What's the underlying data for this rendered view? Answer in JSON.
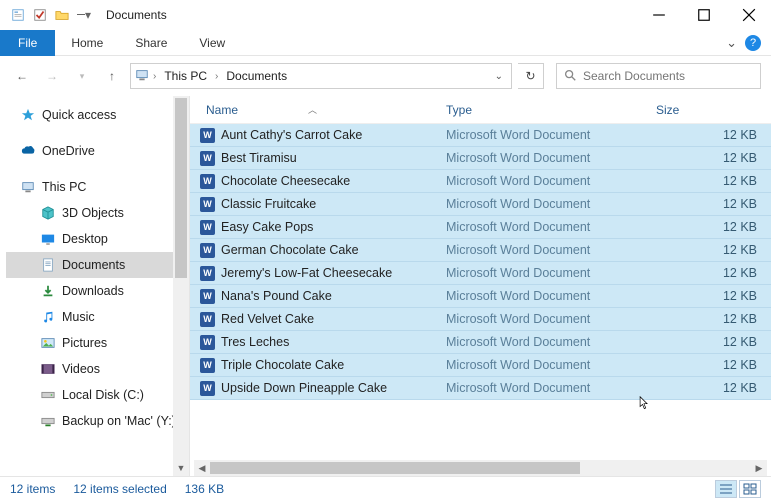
{
  "window": {
    "title": "Documents"
  },
  "ribbon": {
    "file": "File",
    "tabs": [
      "Home",
      "Share",
      "View"
    ]
  },
  "address": {
    "crumbs": [
      "This PC",
      "Documents"
    ]
  },
  "search": {
    "placeholder": "Search Documents"
  },
  "sidebar": {
    "quick_access": "Quick access",
    "onedrive": "OneDrive",
    "this_pc": "This PC",
    "items": [
      {
        "label": "3D Objects"
      },
      {
        "label": "Desktop"
      },
      {
        "label": "Documents"
      },
      {
        "label": "Downloads"
      },
      {
        "label": "Music"
      },
      {
        "label": "Pictures"
      },
      {
        "label": "Videos"
      },
      {
        "label": "Local Disk (C:)"
      },
      {
        "label": "Backup on 'Mac' (Y:)"
      }
    ]
  },
  "columns": {
    "name": "Name",
    "type": "Type",
    "size": "Size"
  },
  "files": [
    {
      "name": "Aunt Cathy's Carrot Cake",
      "type": "Microsoft Word Document",
      "size": "12 KB"
    },
    {
      "name": "Best Tiramisu",
      "type": "Microsoft Word Document",
      "size": "12 KB"
    },
    {
      "name": "Chocolate Cheesecake",
      "type": "Microsoft Word Document",
      "size": "12 KB"
    },
    {
      "name": "Classic Fruitcake",
      "type": "Microsoft Word Document",
      "size": "12 KB"
    },
    {
      "name": "Easy Cake Pops",
      "type": "Microsoft Word Document",
      "size": "12 KB"
    },
    {
      "name": "German Chocolate Cake",
      "type": "Microsoft Word Document",
      "size": "12 KB"
    },
    {
      "name": "Jeremy's Low-Fat Cheesecake",
      "type": "Microsoft Word Document",
      "size": "12 KB"
    },
    {
      "name": "Nana's Pound Cake",
      "type": "Microsoft Word Document",
      "size": "12 KB"
    },
    {
      "name": "Red Velvet Cake",
      "type": "Microsoft Word Document",
      "size": "12 KB"
    },
    {
      "name": "Tres Leches",
      "type": "Microsoft Word Document",
      "size": "12 KB"
    },
    {
      "name": "Triple Chocolate Cake",
      "type": "Microsoft Word Document",
      "size": "12 KB"
    },
    {
      "name": "Upside Down Pineapple Cake",
      "type": "Microsoft Word Document",
      "size": "12 KB"
    }
  ],
  "status": {
    "count": "12 items",
    "selected": "12 items selected",
    "size": "136 KB"
  },
  "icons": {
    "word": "W"
  }
}
